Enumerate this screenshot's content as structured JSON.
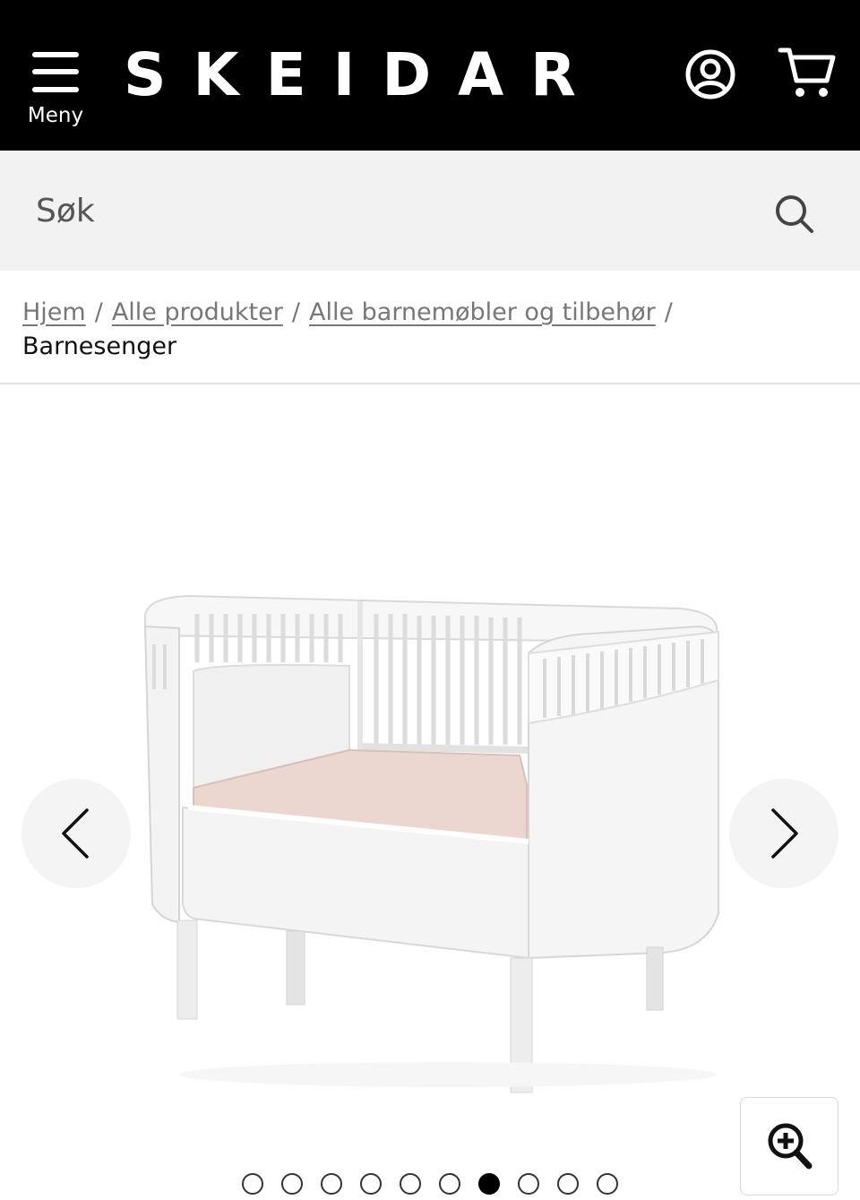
{
  "header": {
    "menu_label": "Meny",
    "logo_text": "SKEIDAR",
    "icons": [
      "menu-icon",
      "account-icon",
      "cart-icon"
    ],
    "background": "#000000"
  },
  "search": {
    "placeholder": "Søk",
    "icon": "search-icon",
    "background": "#f2f2f2"
  },
  "breadcrumb": {
    "links": [
      "Hjem",
      "Alle produkter",
      "Alle barnemøbler og tilbehør"
    ],
    "separator": "/",
    "current": "Barnesenger"
  },
  "gallery": {
    "prev_icon": "chevron-left-icon",
    "next_icon": "chevron-right-icon",
    "zoom_icon": "zoom-in-icon",
    "image_count": 10,
    "active_index": 6
  }
}
